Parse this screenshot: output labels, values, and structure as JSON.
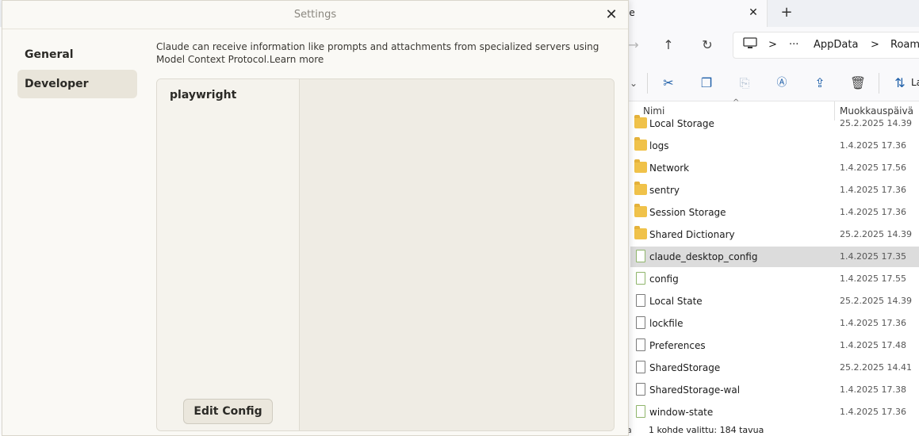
{
  "explorer": {
    "tab_label": "le",
    "tab_close": "✕",
    "new_tab": "+",
    "nav": {
      "back": "→",
      "up": "↑",
      "refresh": "↻"
    },
    "breadcrumb": [
      "AppData",
      "Roami"
    ],
    "breadcrumb_more": "···",
    "breadcrumb_sep": ">",
    "toolbar_partial_label": "La",
    "columns": {
      "name": "Nimi",
      "date": "Muokkauspäivä"
    },
    "files": [
      {
        "name": "Local Storage",
        "date": "25.2.2025 14.39",
        "type": "folder"
      },
      {
        "name": "logs",
        "date": "1.4.2025 17.36",
        "type": "folder"
      },
      {
        "name": "Network",
        "date": "1.4.2025 17.56",
        "type": "folder"
      },
      {
        "name": "sentry",
        "date": "1.4.2025 17.36",
        "type": "folder"
      },
      {
        "name": "Session Storage",
        "date": "1.4.2025 17.36",
        "type": "folder"
      },
      {
        "name": "Shared Dictionary",
        "date": "25.2.2025 14.39",
        "type": "folder"
      },
      {
        "name": "claude_desktop_config",
        "date": "1.4.2025 17.35",
        "type": "json",
        "selected": true
      },
      {
        "name": "config",
        "date": "1.4.2025 17.55",
        "type": "json"
      },
      {
        "name": "Local State",
        "date": "25.2.2025 14.39",
        "type": "file"
      },
      {
        "name": "lockfile",
        "date": "1.4.2025 17.36",
        "type": "file"
      },
      {
        "name": "Preferences",
        "date": "1.4.2025 17.48",
        "type": "file"
      },
      {
        "name": "SharedStorage",
        "date": "25.2.2025 14.41",
        "type": "file"
      },
      {
        "name": "SharedStorage-wal",
        "date": "1.4.2025 17.38",
        "type": "file"
      },
      {
        "name": "window-state",
        "date": "1.4.2025 17.36",
        "type": "json"
      }
    ],
    "status_left": "a",
    "status": "1 kohde valittu: 184 tavua"
  },
  "settings": {
    "title": "Settings",
    "close": "✕",
    "sidebar": [
      {
        "label": "General",
        "active": false
      },
      {
        "label": "Developer",
        "active": true
      }
    ],
    "intro_text": "Claude can receive information like prompts and attachments from specialized servers using Model Context Protocol.",
    "learn_more": "Learn more",
    "servers": [
      "playwright"
    ],
    "edit_config_label": "Edit Config"
  },
  "colors": {
    "dialog_bg": "#faf9f5",
    "active_sidebar": "#e9e5da",
    "folder": "#f0c24a",
    "selected_row": "#dcdcdc",
    "accent_icon": "#1d5ea8"
  }
}
